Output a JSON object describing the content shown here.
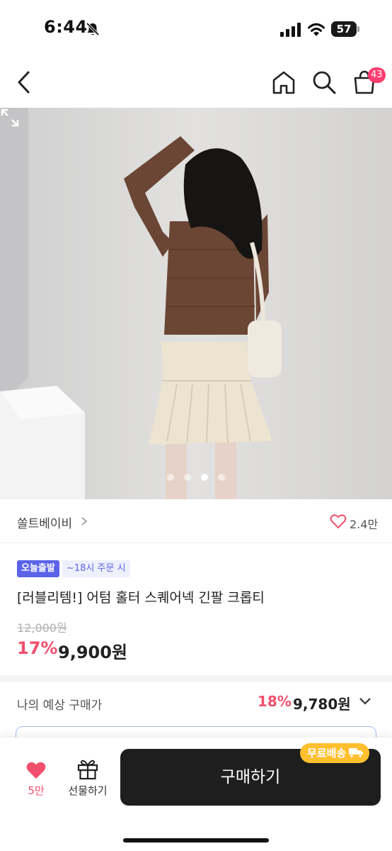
{
  "status_bar": {
    "time": "6:44",
    "battery": "57"
  },
  "nav": {
    "cart_count": "43"
  },
  "product_image": {
    "current_slide": 3,
    "total_slides": 4
  },
  "brand": {
    "name": "쏠트베이비",
    "likes": "2.4만"
  },
  "badges": {
    "today_shipping": "오늘출발",
    "cutoff": "~18시 주문 시"
  },
  "product": {
    "title": "[러블리템!] 어텀 홀터 스퀘어넥 긴팔 크롭티",
    "original_price": "12,000원",
    "discount_rate": "17%",
    "sale_price": "9,900원"
  },
  "expected": {
    "label": "나의 예상 구매가",
    "rate": "18%",
    "price": "9,780원"
  },
  "bottom_bar": {
    "wish_count": "5만",
    "gift_label": "선물하기",
    "buy_label": "구매하기",
    "free_shipping": "무료배송"
  },
  "colors": {
    "accent_pink": "#f0506e",
    "badge_blue": "#5b63e8",
    "free_shipping_yellow": "#ffbf2e",
    "buy_button": "#1e1e1e",
    "cart_badge": "#ff3d6e"
  },
  "icons": [
    "back-icon",
    "home-icon",
    "search-icon",
    "cart-icon",
    "expand-icon",
    "heart-icon",
    "gift-icon",
    "truck-icon",
    "chevron-down-icon"
  ]
}
